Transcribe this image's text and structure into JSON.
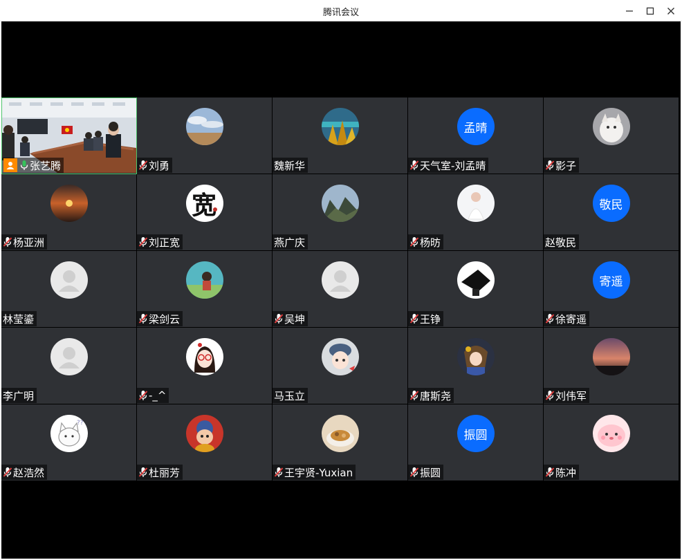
{
  "window": {
    "title": "腾讯会议"
  },
  "participants": [
    {
      "name": "张艺腾",
      "mic": "on",
      "avatar": "video-conference-room",
      "host": true
    },
    {
      "name": "刘勇",
      "mic": "muted",
      "avatar": "sky-landscape-photo"
    },
    {
      "name": "魏新华",
      "mic": "none",
      "avatar": "autumn-trees-photo"
    },
    {
      "name": "天气室-刘孟晴",
      "mic": "muted",
      "avatar_text": "孟晴"
    },
    {
      "name": "影子",
      "mic": "muted",
      "avatar": "white-cat-photo"
    },
    {
      "name": "杨亚洲",
      "mic": "muted",
      "avatar": "sunset-photo"
    },
    {
      "name": "刘正宽",
      "mic": "muted",
      "avatar": "calligraphy-kuan"
    },
    {
      "name": "燕广庆",
      "mic": "none",
      "avatar": "mountain-photo"
    },
    {
      "name": "杨昉",
      "mic": "muted",
      "avatar": "girl-white-dress-photo"
    },
    {
      "name": "赵敬民",
      "mic": "none",
      "avatar_text": "敬民"
    },
    {
      "name": "林莹鎏",
      "mic": "none",
      "avatar": "default-user"
    },
    {
      "name": "梁剑云",
      "mic": "muted",
      "avatar": "anime-scene-photo"
    },
    {
      "name": "吴坤",
      "mic": "muted",
      "avatar": "default-user"
    },
    {
      "name": "王铮",
      "mic": "muted",
      "avatar": "black-shape-photo"
    },
    {
      "name": "徐寄遥",
      "mic": "muted",
      "avatar_text": "寄遥"
    },
    {
      "name": "李广明",
      "mic": "none",
      "avatar": "default-user"
    },
    {
      "name": "-_^",
      "mic": "muted",
      "avatar": "cartoon-girl-glasses"
    },
    {
      "name": "马玉立",
      "mic": "none",
      "avatar": "cartoon-girl-hat"
    },
    {
      "name": "唐斯尧",
      "mic": "muted",
      "avatar": "anime-character"
    },
    {
      "name": "刘伟军",
      "mic": "muted",
      "avatar": "dusk-sky-photo"
    },
    {
      "name": "赵浩然",
      "mic": "muted",
      "avatar": "cartoon-cat"
    },
    {
      "name": "杜丽芳",
      "mic": "muted",
      "avatar": "cartoon-boy-red"
    },
    {
      "name": "王宇贤-Yuxian",
      "mic": "muted",
      "avatar": "food-bowl-photo"
    },
    {
      "name": "振圆",
      "mic": "muted",
      "avatar_text": "振圆"
    },
    {
      "name": "陈冲",
      "mic": "muted",
      "avatar": "pink-cartoon-face"
    }
  ],
  "colors": {
    "tile_bg": "#2f3135",
    "text_avatar_bg": "#0a6cff",
    "mic_muted": "#e03e3e",
    "mic_on": "#36c25b",
    "host_badge": "#ff8a00",
    "active_border": "#4cc46a"
  }
}
